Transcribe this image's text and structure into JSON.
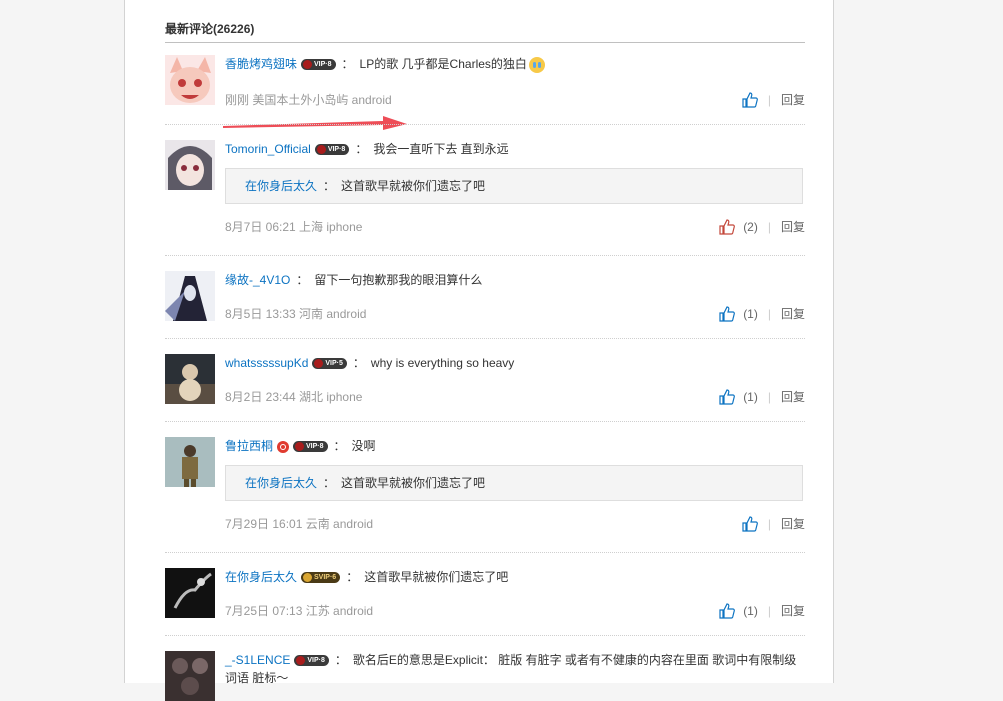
{
  "section_title": "最新评论(26226)",
  "reply_label": "回复",
  "comments": [
    {
      "username": "香脆烤鸡翅味",
      "badge": "VIP·8",
      "text": "LP的歌 几乎都是Charles的独白",
      "meta": "刚刚 美国本土外小岛屿 android",
      "likes": ""
    },
    {
      "username": "Tomorin_Official",
      "badge": "VIP·8",
      "text": "我会一直听下去 直到永远",
      "quote_user": "在你身后太久",
      "quote_text": "这首歌早就被你们遗忘了吧",
      "meta": "8月7日 06:21 上海 iphone",
      "likes": "(2)"
    },
    {
      "username": "缘故-_4V1O",
      "text": "留下一句抱歉那我的眼泪算什么",
      "meta": "8月5日 13:33 河南 android",
      "likes": "(1)"
    },
    {
      "username": "whatsssssupKd",
      "badge": "VIP·5",
      "text": "why is everything so heavy",
      "meta": "8月2日 23:44 湖北 iphone",
      "likes": "(1)"
    },
    {
      "username": "鲁拉西桐",
      "badge": "VIP·8",
      "text": "没啊",
      "quote_user": "在你身后太久",
      "quote_text": "这首歌早就被你们遗忘了吧",
      "meta": "7月29日 16:01 云南 android",
      "likes": ""
    },
    {
      "username": "在你身后太久",
      "badge": "SVIP·6",
      "text": "这首歌早就被你们遗忘了吧",
      "meta": "7月25日 07:13 江苏 android",
      "likes": "(1)"
    },
    {
      "username": "_-S1LENCE",
      "badge": "VIP·8",
      "text": "歌名后E的意思是Explicit： 脏版 有脏字 或者有不健康的内容在里面 歌词中有限制级词语 脏标～",
      "meta": "",
      "likes": ""
    }
  ]
}
